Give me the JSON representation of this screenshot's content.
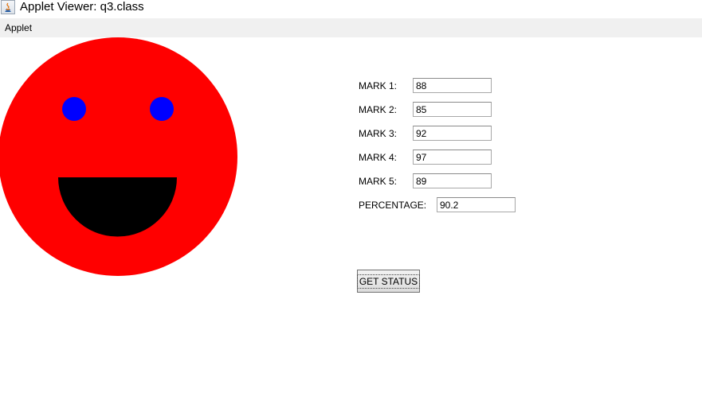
{
  "window": {
    "title": "Applet Viewer: q3.class",
    "icon": "java-icon"
  },
  "menubar": {
    "items": [
      "Applet"
    ]
  },
  "face": {
    "face_color": "#ff0000",
    "eye_color": "#0000ff",
    "mouth_color": "#000000"
  },
  "form": {
    "marks": [
      {
        "label": "MARK 1:",
        "value": "88"
      },
      {
        "label": "MARK 2:",
        "value": "85"
      },
      {
        "label": "MARK 3:",
        "value": "92"
      },
      {
        "label": "MARK 4:",
        "value": "97"
      },
      {
        "label": "MARK 5:",
        "value": "89"
      }
    ],
    "percentage": {
      "label": "PERCENTAGE:",
      "value": "90.2"
    },
    "button_label": "GET STATUS"
  }
}
